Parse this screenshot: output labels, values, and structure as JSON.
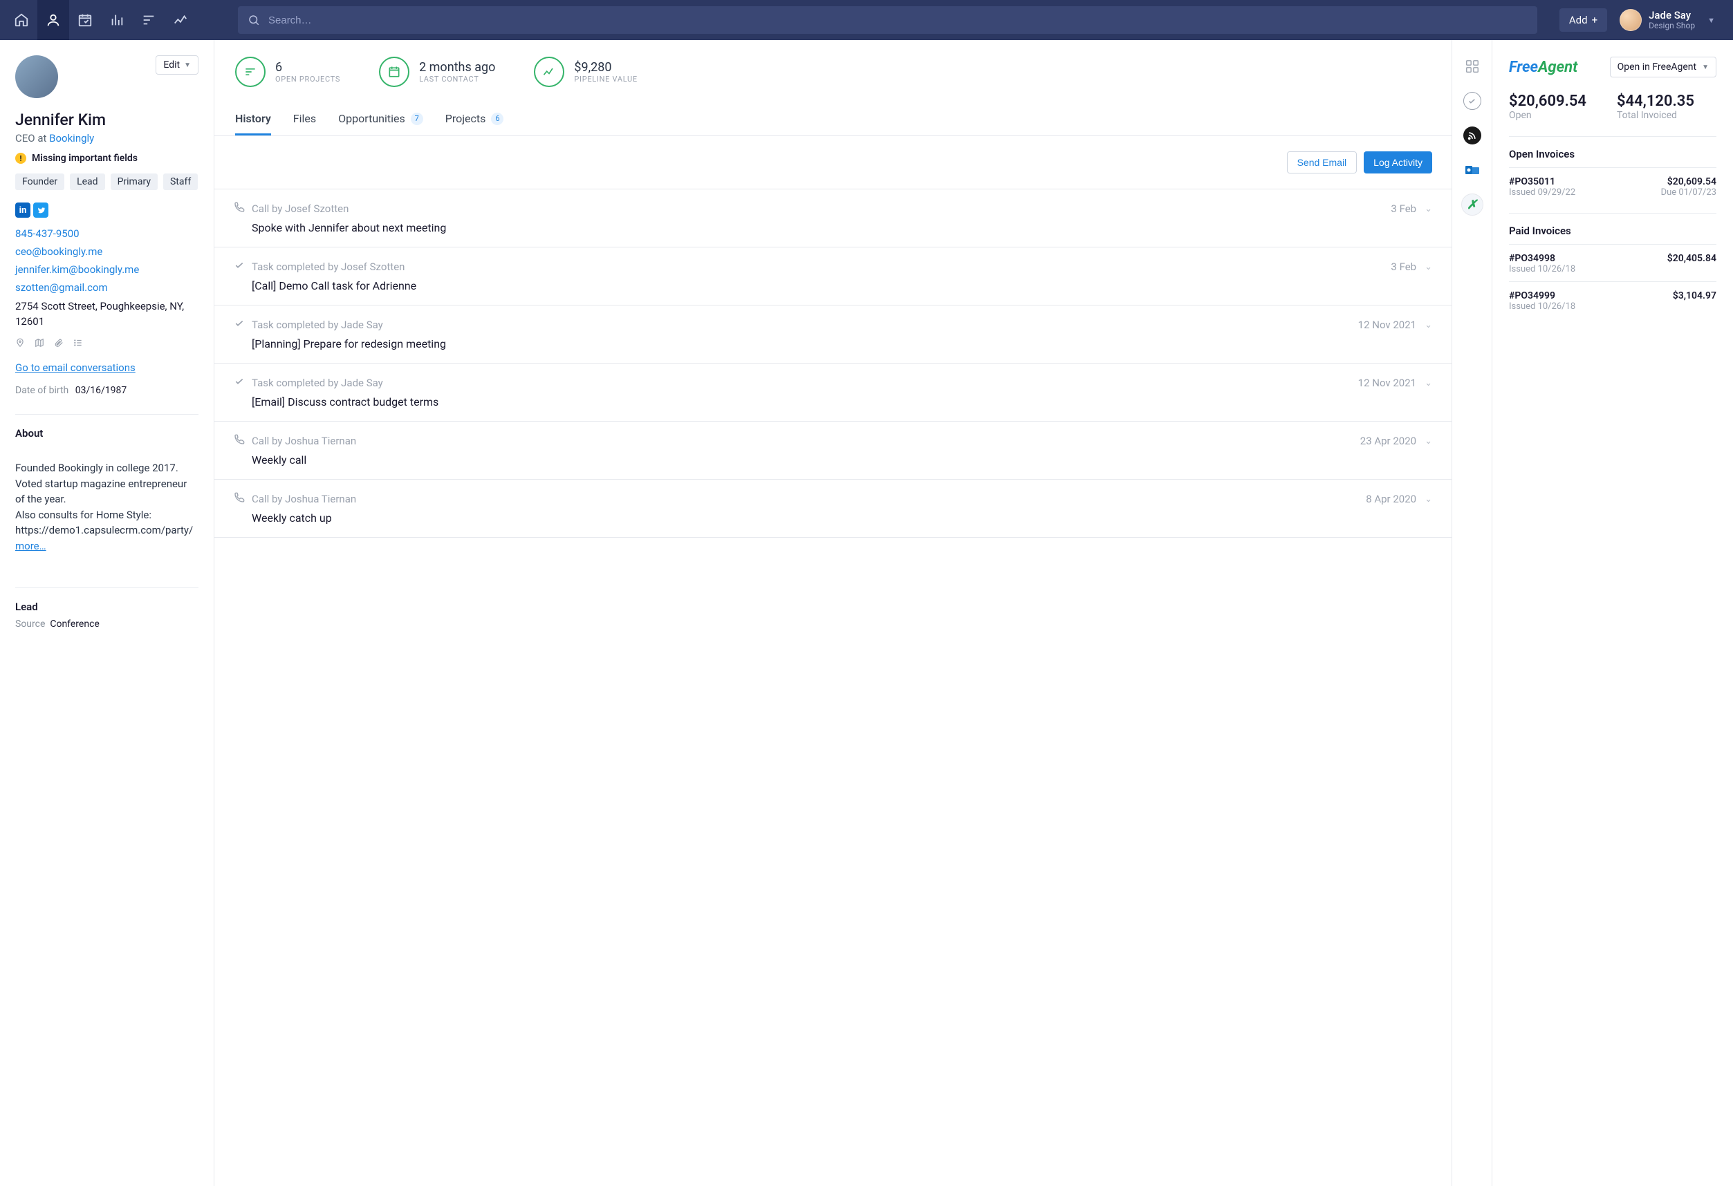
{
  "topbar": {
    "search_placeholder": "Search…",
    "add_label": "Add",
    "user": {
      "name": "Jade Say",
      "org": "Design Shop"
    }
  },
  "contact": {
    "name": "Jennifer Kim",
    "title_prefix": "CEO at ",
    "company": "Bookingly",
    "warning": "Missing important fields",
    "tags": [
      "Founder",
      "Lead",
      "Primary",
      "Staff"
    ],
    "phone": "845-437-9500",
    "emails": [
      "ceo@bookingly.me",
      "jennifer.kim@bookingly.me",
      "szotten@gmail.com"
    ],
    "address": "2754 Scott Street, Poughkeepsie, NY, 12601",
    "email_conversations_link": "Go to email conversations",
    "dob_label": "Date of birth",
    "dob": "03/16/1987",
    "about_heading": "About",
    "about": "Founded Bookingly in college 2017.\nVoted startup magazine entrepreneur of the year.\nAlso consults for Home Style: https://demo1.capsulecrm.com/party/",
    "more": "more…",
    "lead_heading": "Lead",
    "lead_source_label": "Source",
    "lead_source": "Conference",
    "edit_label": "Edit"
  },
  "stats": {
    "open_projects": {
      "value": "6",
      "label": "OPEN PROJECTS"
    },
    "last_contact": {
      "value": "2 months ago",
      "label": "LAST CONTACT"
    },
    "pipeline": {
      "value": "$9,280",
      "label": "PIPELINE VALUE"
    }
  },
  "tabs": {
    "history": "History",
    "files": "Files",
    "opportunities": "Opportunities",
    "opportunities_count": "7",
    "projects": "Projects",
    "projects_count": "6"
  },
  "actions": {
    "send_email": "Send Email",
    "log_activity": "Log Activity"
  },
  "history": [
    {
      "icon": "phone",
      "meta": "Call by Josef Szotten",
      "date": "3 Feb",
      "title": "Spoke with Jennifer about next meeting"
    },
    {
      "icon": "check",
      "meta": "Task completed by Josef Szotten",
      "date": "3 Feb",
      "title": "[Call] Demo Call task for Adrienne"
    },
    {
      "icon": "check",
      "meta": "Task completed by Jade Say",
      "date": "12 Nov 2021",
      "title": "[Planning] Prepare for redesign meeting"
    },
    {
      "icon": "check",
      "meta": "Task completed by Jade Say",
      "date": "12 Nov 2021",
      "title": "[Email] Discuss contract budget terms"
    },
    {
      "icon": "phone",
      "meta": "Call by Joshua Tiernan",
      "date": "23 Apr 2020",
      "title": "Weekly call"
    },
    {
      "icon": "phone",
      "meta": "Call by Joshua Tiernan",
      "date": "8 Apr 2020",
      "title": "Weekly catch up"
    }
  ],
  "freeagent": {
    "open_button": "Open in FreeAgent",
    "open_value": "$20,609.54",
    "open_label": "Open",
    "total_value": "$44,120.35",
    "total_label": "Total Invoiced",
    "open_heading": "Open Invoices",
    "paid_heading": "Paid Invoices",
    "open_invoices": [
      {
        "id": "#PO35011",
        "issued": "Issued 09/29/22",
        "amount": "$20,609.54",
        "due": "Due 01/07/23"
      }
    ],
    "paid_invoices": [
      {
        "id": "#PO34998",
        "issued": "Issued 10/26/18",
        "amount": "$20,405.84"
      },
      {
        "id": "#PO34999",
        "issued": "Issued 10/26/18",
        "amount": "$3,104.97"
      }
    ]
  }
}
